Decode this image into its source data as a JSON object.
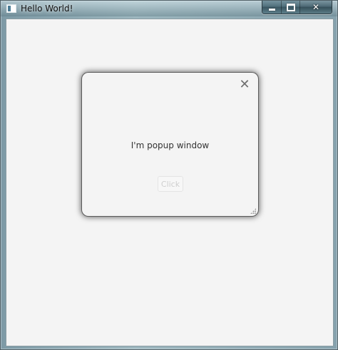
{
  "window": {
    "title": "Hello World!",
    "minimize_icon": "minimize-icon",
    "maximize_icon": "maximize-icon",
    "close_icon": "close-icon",
    "close_glyph": "✕"
  },
  "popup": {
    "message": "I'm popup window",
    "close_glyph": "✕",
    "button_label": "Click"
  }
}
